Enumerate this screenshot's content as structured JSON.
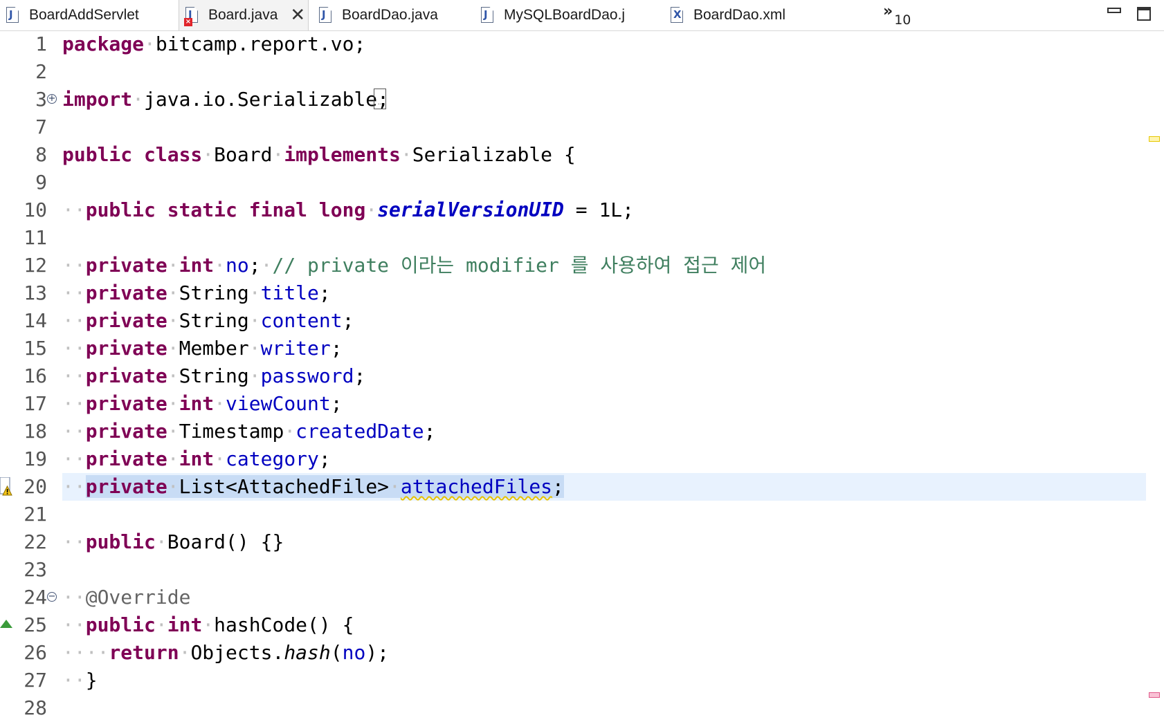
{
  "tabs": [
    {
      "label": "BoardAddServlet",
      "icon": "java-file-icon",
      "active": false,
      "error": false
    },
    {
      "label": "Board.java",
      "icon": "java-file-icon",
      "active": true,
      "error": true,
      "close": "✕"
    },
    {
      "label": "BoardDao.java",
      "icon": "java-file-icon",
      "active": false,
      "error": false
    },
    {
      "label": "MySQLBoardDao.j",
      "icon": "java-file-icon",
      "active": false,
      "error": false
    },
    {
      "label": "BoardDao.xml",
      "icon": "xml-file-icon",
      "active": false,
      "error": false
    }
  ],
  "overflow": {
    "symbol": "»",
    "count": "10"
  },
  "colors": {
    "keyword": "#7f0055",
    "field": "#0000c0",
    "comment": "#3f7f5f",
    "annotation": "#646464",
    "current_line": "#e8f2fe",
    "selection": "#c8dcf5"
  },
  "code": {
    "l1": {
      "num": "1",
      "kw": "package",
      "rest": "bitcamp.report.vo;"
    },
    "l2": {
      "num": "2"
    },
    "l3": {
      "num": "3",
      "kw": "import",
      "rest": "java.io.Serializable;"
    },
    "l7": {
      "num": "7"
    },
    "l8": {
      "num": "8",
      "kw": "public class",
      "name": "Board",
      "kw2": "implements",
      "rest": "Serializable {"
    },
    "l9": {
      "num": "9"
    },
    "l10": {
      "num": "10",
      "kw": "public static final long",
      "field": "serialVersionUID",
      "rest": " = 1L;"
    },
    "l11": {
      "num": "11"
    },
    "l12": {
      "num": "12",
      "kw": "private",
      "kw2": "int",
      "field": "no",
      "rest": ";",
      "comment": "// private 이라는 modifier 를 사용하여 접근 제어"
    },
    "l13": {
      "num": "13",
      "kw": "private",
      "type": "String",
      "field": "title",
      "rest": ";"
    },
    "l14": {
      "num": "14",
      "kw": "private",
      "type": "String",
      "field": "content",
      "rest": ";"
    },
    "l15": {
      "num": "15",
      "kw": "private",
      "type": "Member",
      "field": "writer",
      "rest": ";"
    },
    "l16": {
      "num": "16",
      "kw": "private",
      "type": "String",
      "field": "password",
      "rest": ";"
    },
    "l17": {
      "num": "17",
      "kw": "private",
      "kw2": "int",
      "field": "viewCount",
      "rest": ";"
    },
    "l18": {
      "num": "18",
      "kw": "private",
      "type": "Timestamp",
      "field": "createdDate",
      "rest": ";"
    },
    "l19": {
      "num": "19",
      "kw": "private",
      "kw2": "int",
      "field": "category",
      "rest": ";"
    },
    "l20": {
      "num": "20",
      "kw": "private",
      "type": "List<AttachedFile>",
      "field": "attachedFiles",
      "rest": ";"
    },
    "l21": {
      "num": "21"
    },
    "l22": {
      "num": "22",
      "kw": "public",
      "rest": "Board() {}"
    },
    "l23": {
      "num": "23"
    },
    "l24": {
      "num": "24",
      "ann": "@Override"
    },
    "l25": {
      "num": "25",
      "kw": "public",
      "kw2": "int",
      "rest": "hashCode() {"
    },
    "l26": {
      "num": "26",
      "kw": "return",
      "obj": "Objects.",
      "method": "hash",
      "open": "(",
      "field": "no",
      "close": ");"
    },
    "l27": {
      "num": "27",
      "rest": "}"
    },
    "l28": {
      "num": "28"
    }
  }
}
